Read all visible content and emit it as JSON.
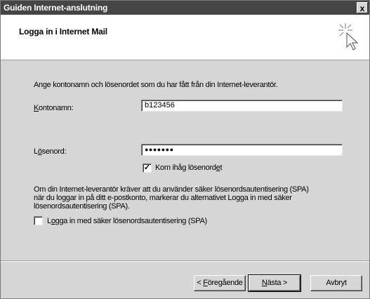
{
  "window": {
    "title": "Guiden Internet-anslutning",
    "close_glyph": "x"
  },
  "header": {
    "title": "Logga in i Internet Mail",
    "icon": "wizard-cursor-icon"
  },
  "intro": "Ange kontonamn och lösenordet som du har fått från din Internet-leverantör.",
  "account": {
    "label_mnemonic": "K",
    "label_rest": "ontonamn:",
    "value": "b123456"
  },
  "password": {
    "label_prefix": "L",
    "label_mnemonic": "ö",
    "label_rest": "senord:",
    "value": "●●●●●●●"
  },
  "remember": {
    "label_prefix": "Kom ihåg lösenord",
    "label_mnemonic": "e",
    "label_rest": "t",
    "checked": true,
    "check_glyph": "✓"
  },
  "spa": {
    "description_lines": [
      "Om din Internet-leverantör kräver att du använder säker lösenordsautentisering (SPA)",
      "när du loggar in på ditt e-postkonto, markerar du alternativet Logga in med säker",
      "lösenordsautentisering (SPA)."
    ],
    "checkbox_label_prefix": "L",
    "checkbox_label_mnemonic": "o",
    "checkbox_label_rest": "gga in med säker lösenordsautentisering (SPA)",
    "checked": false
  },
  "buttons": {
    "back_prefix": "< ",
    "back_mnemonic": "F",
    "back_rest": "öregående",
    "next_mnemonic": "N",
    "next_rest": "ästa >",
    "cancel": "Avbryt"
  }
}
